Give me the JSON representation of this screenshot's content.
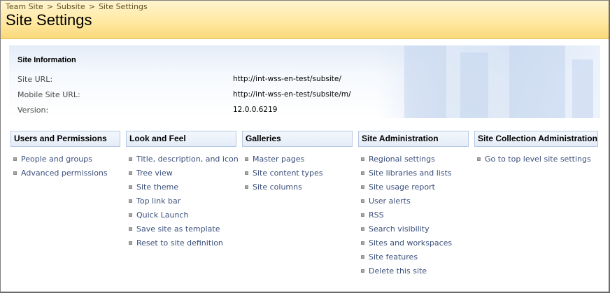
{
  "breadcrumb": {
    "items": [
      "Team Site",
      "Subsite",
      "Site Settings"
    ],
    "separator": ">"
  },
  "page": {
    "title": "Site Settings"
  },
  "site_info": {
    "title": "Site Information",
    "rows": [
      {
        "label": "Site URL:",
        "value": "http://int-wss-en-test/subsite/"
      },
      {
        "label": "Mobile Site URL:",
        "value": "http://int-wss-en-test/subsite/m/"
      },
      {
        "label": "Version:",
        "value": "12.0.0.6219"
      }
    ]
  },
  "sections": [
    {
      "title": "Users and Permissions",
      "links": [
        "People and groups",
        "Advanced permissions"
      ]
    },
    {
      "title": "Look and Feel",
      "links": [
        "Title, description, and icon",
        "Tree view",
        "Site theme",
        "Top link bar",
        "Quick Launch",
        "Save site as template",
        "Reset to site definition"
      ]
    },
    {
      "title": "Galleries",
      "links": [
        "Master pages",
        "Site content types",
        "Site columns"
      ]
    },
    {
      "title": "Site Administration",
      "links": [
        "Regional settings",
        "Site libraries and lists",
        "Site usage report",
        "User alerts",
        "RSS",
        "Search visibility",
        "Sites and workspaces",
        "Site features",
        "Delete this site"
      ]
    },
    {
      "title": "Site Collection Administration",
      "links": [
        "Go to top level site settings"
      ]
    }
  ],
  "colors": {
    "title_band": "#ffe9a3",
    "link": "#3b4f7a",
    "header_border": "#b6c9e5"
  }
}
